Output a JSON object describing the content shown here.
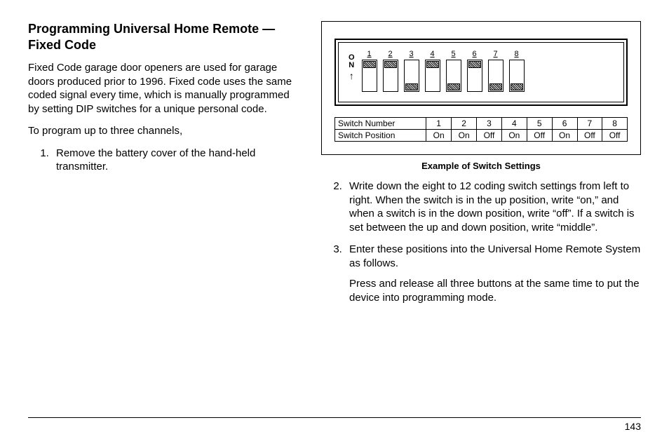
{
  "heading": "Programming Universal Home Remote — Fixed Code",
  "para1": "Fixed Code garage door openers are used for garage doors produced prior to 1996. Fixed code uses the same coded signal every time, which is manually programmed by setting DIP switches for a unique personal code.",
  "para2": "To program up to three channels,",
  "step1": "Remove the battery cover of the hand-held transmitter.",
  "figure": {
    "on_label_o": "O",
    "on_label_n": "N",
    "switches": [
      {
        "num": "1",
        "pos": "On"
      },
      {
        "num": "2",
        "pos": "On"
      },
      {
        "num": "3",
        "pos": "Off"
      },
      {
        "num": "4",
        "pos": "On"
      },
      {
        "num": "5",
        "pos": "Off"
      },
      {
        "num": "6",
        "pos": "On"
      },
      {
        "num": "7",
        "pos": "Off"
      },
      {
        "num": "8",
        "pos": "Off"
      }
    ],
    "row_number_label": "Switch Number",
    "row_position_label": "Switch Position",
    "caption": "Example of Switch Settings"
  },
  "step2": "Write down the eight to 12 coding switch settings from left to right. When the switch is in the up position, write “on,” and when a switch is in the down position, write “off”. If a switch is set between the up and down position, write “middle”.",
  "step3": "Enter these positions into the Universal Home Remote System as follows.",
  "step3_sub": "Press and release all three buttons at the same time to put the device into programming mode.",
  "page_number": "143"
}
